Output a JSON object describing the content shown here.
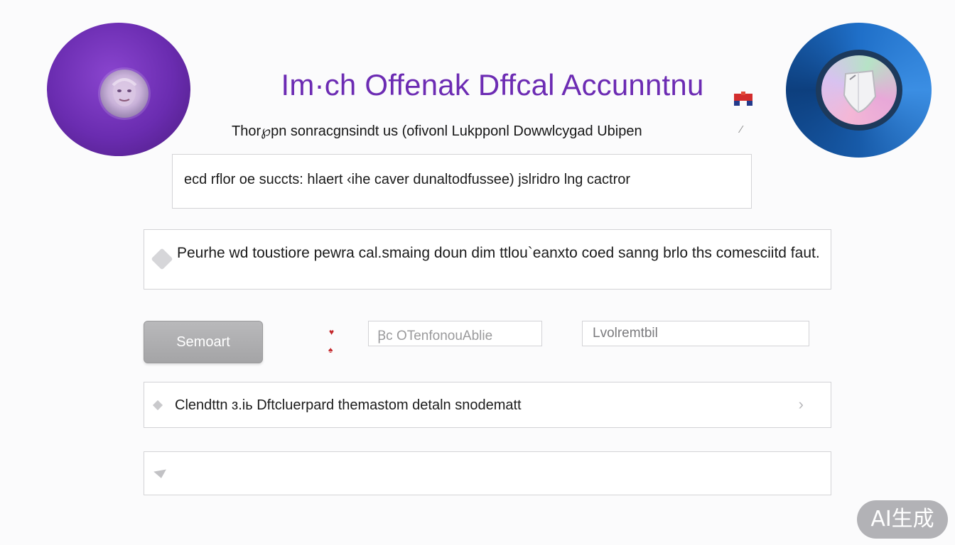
{
  "header": {
    "title": "Im·ch Offenak Dffcal Accunntnu",
    "subtitle": "Thor℘pn sonracgnsindt us (ofivonl Lukpponl Dowwlcygad Ubipen",
    "edit_icon": "pencil-icon",
    "badge_icon": "red-blue-flag-icon",
    "left_avatar_icon": "user-avatar-icon",
    "right_logo_icon": "shield-icon"
  },
  "info_box": {
    "text": "ecd rflor oe succts: hlaert ‹ihe caver dunaltodfussee) jslridro lng cactror"
  },
  "description": {
    "icon": "tag-icon",
    "text": "Peurhe wd toustiore pewra cal.smaing doun dim ttlou`eanxto coed sanng brlo ths comesciitd faut."
  },
  "actions": {
    "primary_label": "Semoart",
    "field_a_value": "Ꞵc OTenfonouAblie",
    "field_b_value": "Lvolremtbil"
  },
  "list_row": {
    "text": "Clendttn ɜ.iь Dftcluerpard themastom detaln snodematt",
    "chevron_icon": "chevron-right-icon",
    "lead_icon": "diamond-icon"
  },
  "empty_row": {
    "icon": "caret-down-icon"
  },
  "watermark": {
    "text": "AI生成"
  },
  "colors": {
    "title": "#6c2bb3",
    "avatar_disc": "#6a2cb0",
    "shield_disc": "#1f6fc8",
    "button": "#ababad"
  }
}
